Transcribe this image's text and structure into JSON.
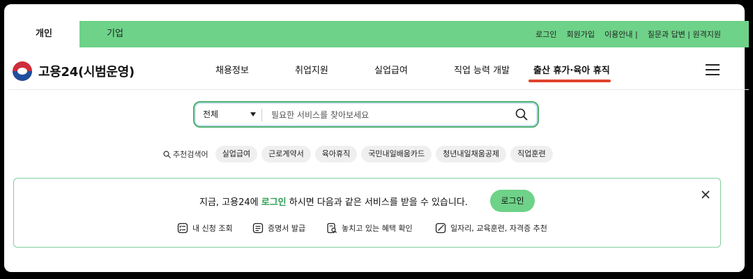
{
  "tabs": [
    {
      "label": "개인"
    },
    {
      "label": "기업"
    }
  ],
  "top_links": [
    "로그인",
    "회원가입",
    "이용안내 |",
    "질문과 답변 | 원격지원"
  ],
  "logo": {
    "text": "고용24(시범운영)"
  },
  "nav": [
    "채용정보",
    "취업지원",
    "실업급여",
    "직업 능력 개발",
    "출산 휴가·육아 휴직"
  ],
  "search": {
    "category": "전체",
    "placeholder": "필요한 서비스를 찾아보세요"
  },
  "recommended": {
    "label": "추천검색어",
    "chips": [
      "실업급여",
      "근로계약서",
      "육아휴직",
      "국민내일배움카드",
      "청년내일채움공제",
      "직업훈련"
    ]
  },
  "login_box": {
    "msg_pre": "지금, 고용24에 ",
    "msg_hl": "로그인",
    "msg_post": " 하시면 다음과 같은 서비스를 받을 수 있습니다.",
    "button": "로그인",
    "services": [
      "내 신청 조회",
      "증명서 발급",
      "놓치고 있는 혜택 확인",
      "일자리, 교육훈련, 자격증 추천"
    ]
  },
  "colors": {
    "brand_green": "#6ed288",
    "accent_red": "#e0442c",
    "highlight_green": "#2f9e54"
  }
}
